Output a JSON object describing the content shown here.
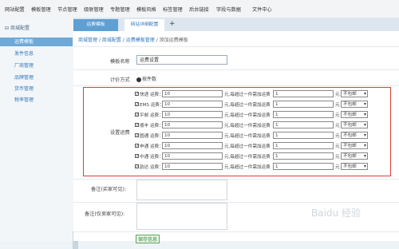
{
  "topnav": [
    "网站配置",
    "模板管理",
    "节点管理",
    "级联管理",
    "专题管理",
    "模板风格",
    "标签管理",
    "后台链接",
    "字段与数据",
    "文件中心"
  ],
  "sidebar": {
    "header": "商城配置",
    "items": [
      "运费模板",
      "发件信息",
      "厂商管理",
      "品牌管理",
      "货币管理",
      "税率管理"
    ]
  },
  "tabs": {
    "tab1": "运费模板",
    "tab2": "网站详细配置",
    "add": "+"
  },
  "breadcrumb": {
    "l1": "商城管理",
    "sep": "/",
    "l2": "商城配置",
    "l3": "运费模板管理",
    "current": "添加运费模板"
  },
  "form": {
    "template_name_label": "模板名称",
    "template_name_value": "运费设置",
    "pricing_label": "计价方式",
    "pricing_option": "按件数",
    "shipping_label": "设置运费",
    "shipping_rows": [
      {
        "name": "快递 运费：",
        "first": "10",
        "mid": "元,每超过一件需加运费",
        "extra": "1",
        "unit": "元",
        "option": "不包邮"
      },
      {
        "name": "EMS 运费：",
        "first": "10",
        "mid": "元,每超过一件需加运费",
        "extra": "1",
        "unit": "元",
        "option": "不包邮"
      },
      {
        "name": "平邮 运费：",
        "first": "10",
        "mid": "元,每超过一件需加运费",
        "extra": "1",
        "unit": "元",
        "option": "不包邮"
      },
      {
        "name": "顺丰 运费：",
        "first": "10",
        "mid": "元,每超过一件需加运费",
        "extra": "1",
        "unit": "元",
        "option": "不包邮"
      },
      {
        "name": "圆通 运费：",
        "first": "10",
        "mid": "元,每超过一件需加运费",
        "extra": "1",
        "unit": "元",
        "option": "不包邮"
      },
      {
        "name": "申通 运费：",
        "first": "10",
        "mid": "元,每超过一件需加运费",
        "extra": "1",
        "unit": "元",
        "option": "不包邮"
      },
      {
        "name": "中通 运费：",
        "first": "10",
        "mid": "元,每超过一件需加运费",
        "extra": "1",
        "unit": "元",
        "option": "不包邮"
      },
      {
        "name": "韵达 运费：",
        "first": "10",
        "mid": "元,每超过一件需加运费",
        "extra": "1",
        "unit": "元",
        "option": "不包邮"
      }
    ],
    "note_buyer_label": "备注(买家可见):",
    "note_admin_label": "备注(仅卖家可见):",
    "save_label": "保存信息"
  },
  "watermark": "Baidu 经验"
}
